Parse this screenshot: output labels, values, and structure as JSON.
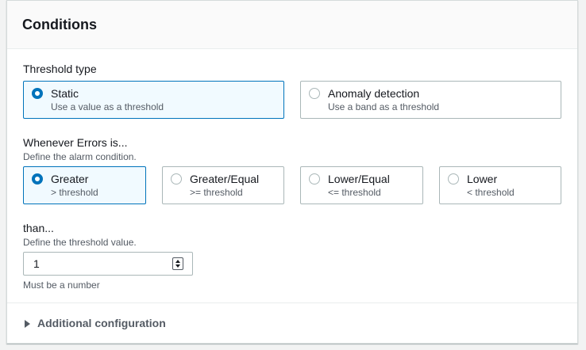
{
  "panel": {
    "title": "Conditions"
  },
  "threshold_type": {
    "label": "Threshold type",
    "options": [
      {
        "title": "Static",
        "subtitle": "Use a value as a threshold",
        "selected": true
      },
      {
        "title": "Anomaly detection",
        "subtitle": "Use a band as a threshold",
        "selected": false
      }
    ]
  },
  "condition": {
    "label": "Whenever Errors is...",
    "description": "Define the alarm condition.",
    "options": [
      {
        "title": "Greater",
        "subtitle": "> threshold",
        "selected": true
      },
      {
        "title": "Greater/Equal",
        "subtitle": ">= threshold",
        "selected": false
      },
      {
        "title": "Lower/Equal",
        "subtitle": "<= threshold",
        "selected": false
      },
      {
        "title": "Lower",
        "subtitle": "< threshold",
        "selected": false
      }
    ]
  },
  "threshold_value": {
    "label": "than...",
    "description": "Define the threshold value.",
    "value": "1",
    "constraint": "Must be a number"
  },
  "additional": {
    "label": "Additional configuration"
  },
  "colors": {
    "accent": "#0073bb",
    "selected_bg": "#f1faff",
    "border": "#aab7b8"
  }
}
